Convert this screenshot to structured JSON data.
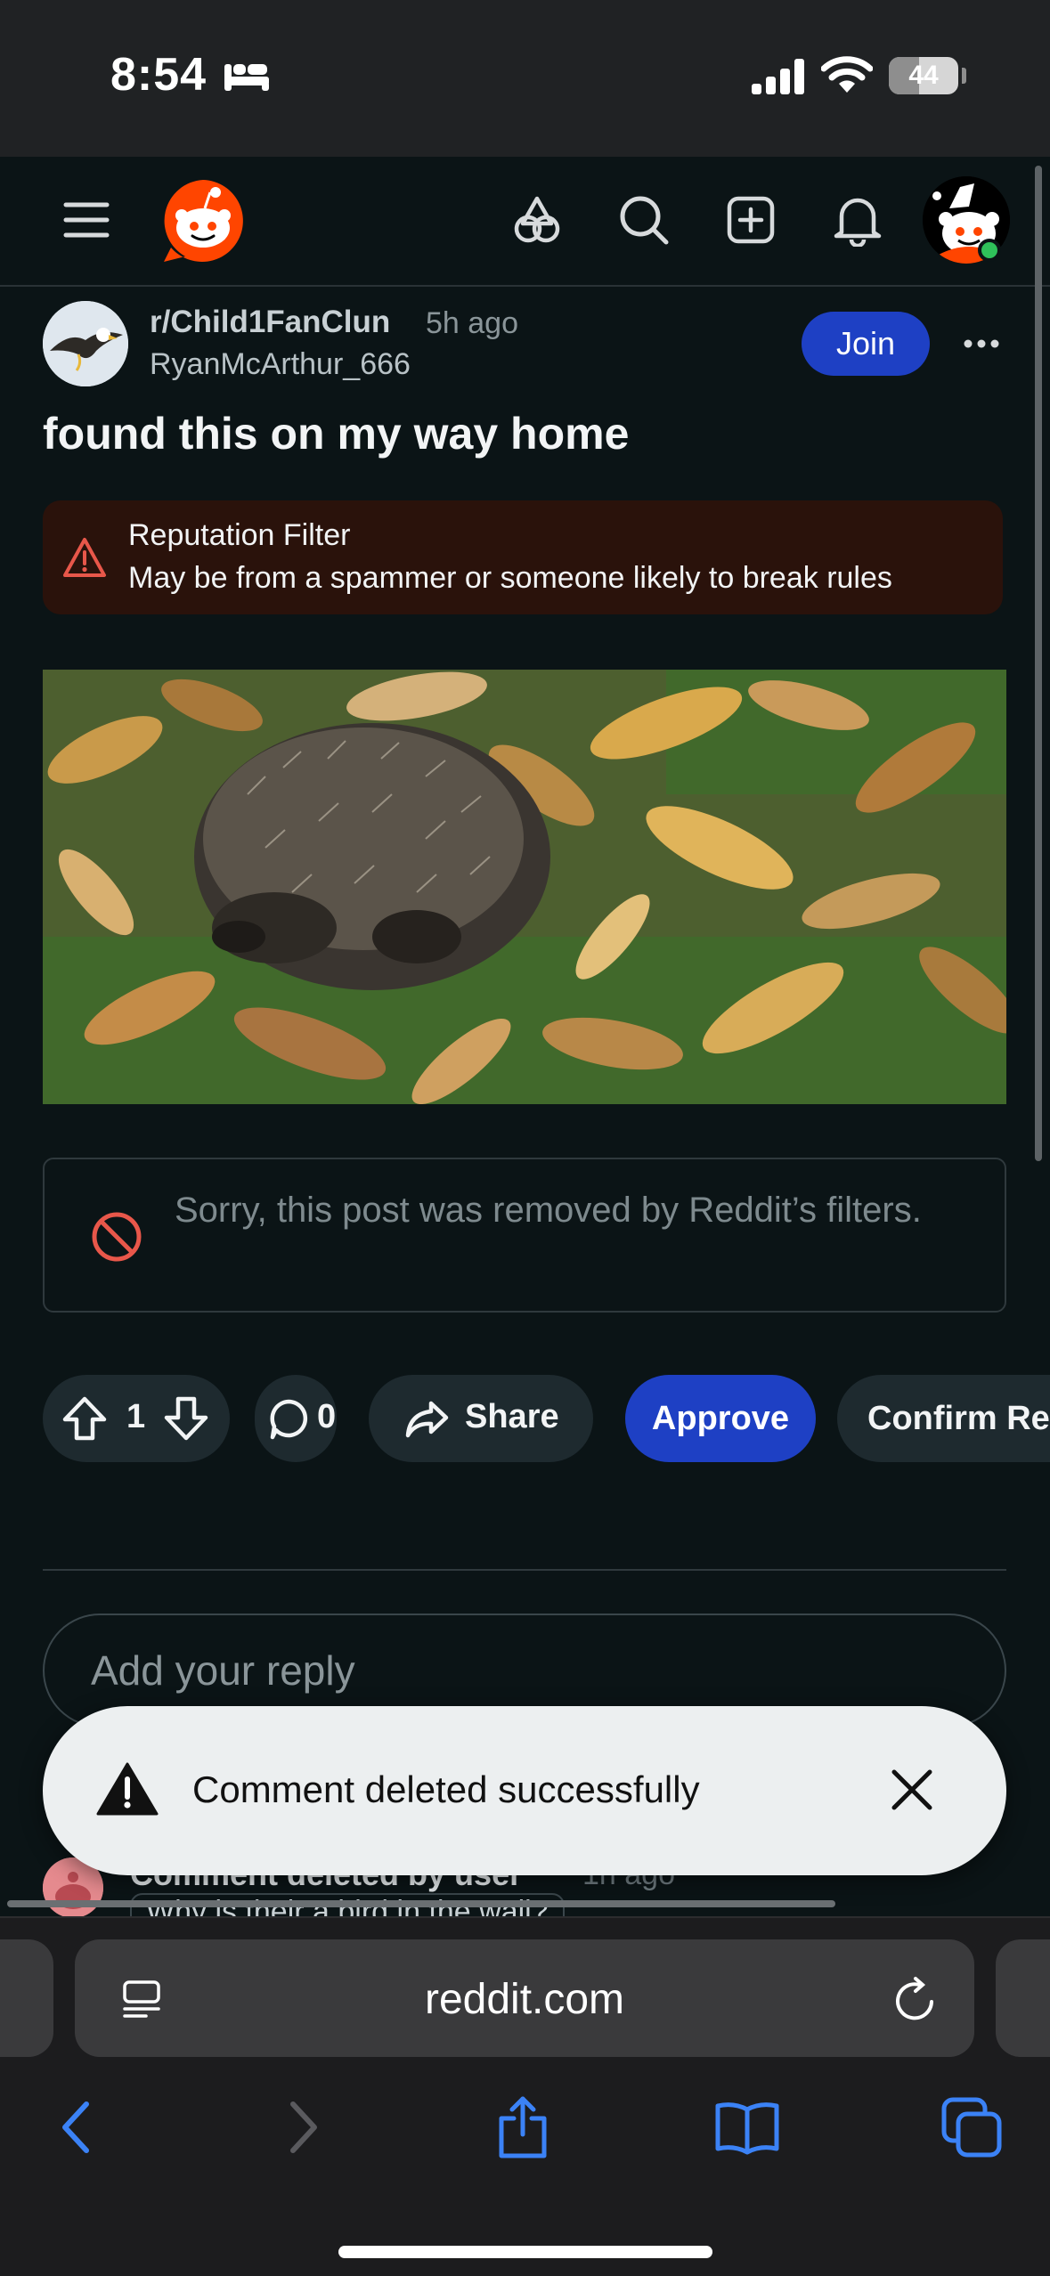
{
  "status_bar": {
    "time": "8:54",
    "battery": "44",
    "battery_level": 0.44
  },
  "header": {
    "menu_icon": "hamburger-menu-icon",
    "logo": "reddit-snoo-logo",
    "icons": [
      "games-icon",
      "search-icon",
      "create-post-icon",
      "notifications-bell-icon"
    ],
    "avatar_status": "online"
  },
  "post": {
    "subreddit": "r/Child1FanClun",
    "time_ago": "5h ago",
    "author": "RyanMcArthur_666",
    "join_label": "Join",
    "title": "found this on my way home",
    "reputation_filter": {
      "title": "Reputation Filter",
      "description": "May be from a spammer or someone likely to break rules"
    },
    "removed_notice": "Sorry, this post was removed by Reddit’s filters.",
    "votes": "1",
    "comments": "0",
    "share_label": "Share",
    "approve_label": "Approve",
    "confirm_label": "Confirm Removal"
  },
  "reply": {
    "placeholder": "Add your reply"
  },
  "comment": {
    "author": "Comment deleted by user",
    "time_ago": "1h ago",
    "body": "Why is their a bird in the wall?"
  },
  "toast": {
    "message": "Comment deleted successfully"
  },
  "safari": {
    "url": "reddit.com"
  },
  "colors": {
    "background": "#0b1416",
    "accent_blue": "#1e40c4",
    "warning_red": "#e8574a",
    "reddit_orange": "#ff4500"
  }
}
